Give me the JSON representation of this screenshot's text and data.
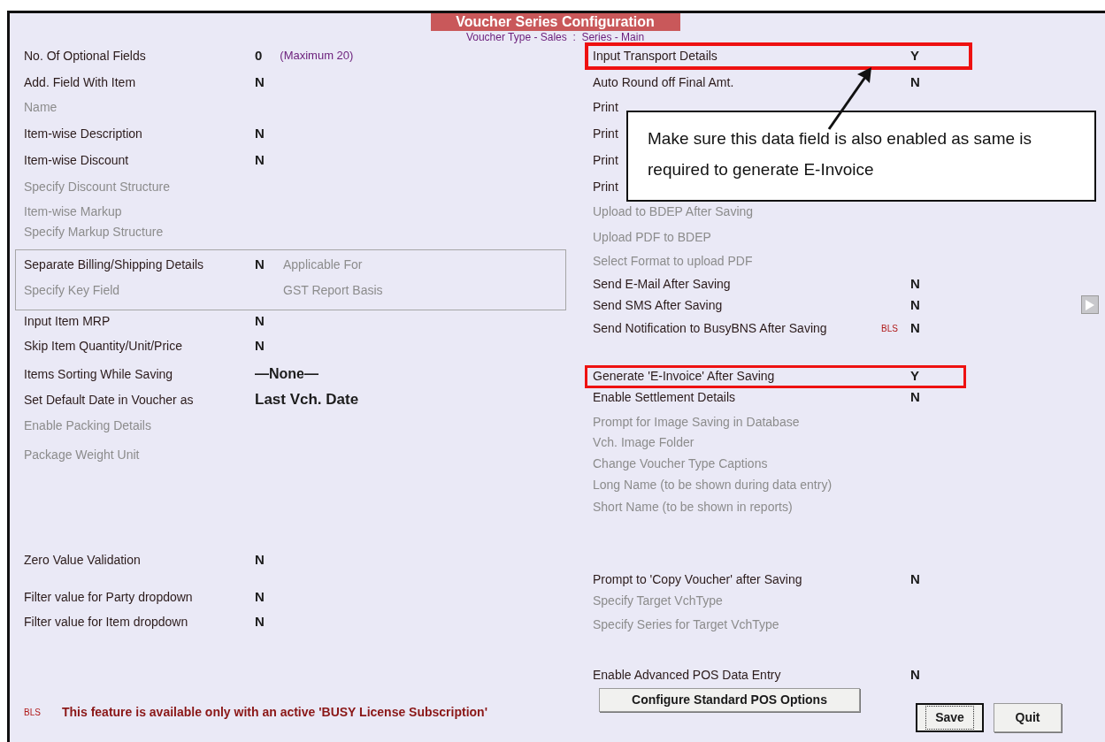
{
  "dialog": {
    "title": "Voucher Series Configuration",
    "subtitle": "Voucher Type - Sales  :  Series - Main"
  },
  "left_fields_top": [
    {
      "label": "No. Of Optional Fields",
      "disabled": false,
      "value": "0",
      "kind": "flag",
      "note": "(Maximum 20)"
    },
    {
      "label": "Add. Field With Item",
      "disabled": false,
      "value": "N",
      "kind": "flag"
    },
    {
      "label": "Name",
      "disabled": true
    },
    {
      "label": "Item-wise Description",
      "disabled": false,
      "value": "N",
      "kind": "flag"
    },
    {
      "label": "Item-wise Discount",
      "disabled": false,
      "value": "N",
      "kind": "flag"
    },
    {
      "label": "Specify Discount Structure",
      "disabled": true
    },
    {
      "label": "Item-wise Markup",
      "disabled": true
    },
    {
      "label": "Specify Markup Structure",
      "disabled": true
    }
  ],
  "billing_group": [
    {
      "label": "Separate Billing/Shipping Details",
      "disabled": false,
      "value": "N",
      "kind": "flag",
      "extra": {
        "label": "Applicable For",
        "disabled": true
      }
    },
    {
      "label": "Specify Key Field",
      "disabled": true,
      "extra": {
        "label": "GST Report Basis",
        "disabled": true
      }
    }
  ],
  "left_fields_bottom": [
    {
      "label": "Input Item MRP",
      "disabled": false,
      "value": "N",
      "kind": "flag"
    },
    {
      "label": "Skip Item Quantity/Unit/Price",
      "disabled": false,
      "value": "N",
      "kind": "flag"
    },
    {
      "label": "Items Sorting While Saving",
      "disabled": false,
      "value": "—None—",
      "kind": "choice"
    },
    {
      "label": "Set Default Date in Voucher as",
      "disabled": false,
      "value": "Last Vch. Date",
      "kind": "setting"
    },
    {
      "label": "Enable Packing Details",
      "disabled": true
    },
    {
      "label": "Package Weight Unit",
      "disabled": true
    },
    {
      "label": "Zero Value Validation",
      "disabled": false,
      "value": "N",
      "kind": "flag"
    },
    {
      "label": "Filter value for Party dropdown",
      "disabled": false,
      "value": "N",
      "kind": "flag"
    },
    {
      "label": "Filter value for Item dropdown",
      "disabled": false,
      "value": "N",
      "kind": "flag"
    }
  ],
  "right_fields": [
    {
      "label": "Input Transport Details",
      "disabled": false,
      "value": "Y",
      "highlighted": true
    },
    {
      "label": "Auto Round off Final Amt.",
      "disabled": false,
      "value": "N",
      "highlighted": false
    },
    {
      "label": "Print",
      "disabled": false,
      "highlighted": false
    },
    {
      "label": "Print",
      "disabled": false,
      "highlighted": false
    },
    {
      "label": "Print",
      "disabled": false,
      "highlighted": false
    },
    {
      "label": "Print",
      "disabled": false,
      "highlighted": false
    },
    {
      "label": "Upload to BDEP After Saving",
      "disabled": true,
      "highlighted": false
    },
    {
      "label": "Upload PDF to BDEP",
      "disabled": true,
      "highlighted": false
    },
    {
      "label": "Select Format to upload PDF",
      "disabled": true,
      "highlighted": false
    },
    {
      "label": "Send E-Mail After Saving",
      "disabled": false,
      "value": "N",
      "highlighted": false
    },
    {
      "label": "Send SMS After Saving",
      "disabled": false,
      "value": "N",
      "highlighted": false
    },
    {
      "label": "Send Notification to BusyBNS After Saving",
      "disabled": false,
      "value": "N",
      "highlighted": false,
      "tag": "BLS"
    },
    {
      "label": "Generate 'E-Invoice' After Saving",
      "disabled": false,
      "value": "Y",
      "highlighted": true
    },
    {
      "label": "Enable Settlement Details",
      "disabled": false,
      "value": "N",
      "highlighted": false
    },
    {
      "label": "Prompt for Image Saving in Database",
      "disabled": true,
      "highlighted": false
    },
    {
      "label": "Vch. Image Folder",
      "disabled": true,
      "highlighted": false
    },
    {
      "label": "Change Voucher Type Captions",
      "disabled": true,
      "highlighted": false
    },
    {
      "label": "Long Name (to be shown during data entry)",
      "disabled": true,
      "highlighted": false
    },
    {
      "label": "Short Name (to be shown in reports)",
      "disabled": true,
      "highlighted": false
    },
    {
      "label": "Prompt to 'Copy Voucher' after Saving",
      "disabled": false,
      "value": "N",
      "highlighted": false
    },
    {
      "label": "Specify Target VchType",
      "disabled": true,
      "highlighted": false
    },
    {
      "label": "Specify Series for Target VchType",
      "disabled": true,
      "highlighted": false
    },
    {
      "label": "Enable Advanced POS Data Entry",
      "disabled": false,
      "value": "N",
      "highlighted": false
    }
  ],
  "footer_note": {
    "tag": "BLS",
    "text": "This feature is available only with an active 'BUSY License Subscription'"
  },
  "buttons": [
    {
      "label": "Configure Standard POS Options",
      "kind": "wide",
      "focused": false
    },
    {
      "label": "Save",
      "kind": "small",
      "focused": true
    },
    {
      "label": "Quit",
      "kind": "small",
      "focused": false
    }
  ],
  "callout": {
    "text": "Make sure this data field is also enabled as same is required to generate E-Invoice"
  }
}
